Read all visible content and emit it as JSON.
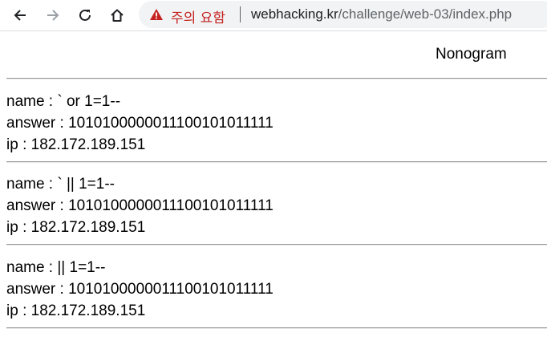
{
  "browser": {
    "back_label": "Back",
    "forward_label": "Forward",
    "reload_label": "Reload",
    "home_label": "Home",
    "security_warning": "주의 요함",
    "url_host": "webhacking.kr",
    "url_path": "/challenge/web-03/index.php"
  },
  "page": {
    "title": "Nonogram"
  },
  "entries": [
    {
      "name": "name : ` or 1=1--",
      "answer": "answer : 1010100000011100101011111",
      "ip": "ip : 182.172.189.151"
    },
    {
      "name": "name : ` || 1=1--",
      "answer": "answer : 1010100000011100101011111",
      "ip": "ip : 182.172.189.151"
    },
    {
      "name": "name : || 1=1--",
      "answer": "answer : 1010100000011100101011111",
      "ip": "ip : 182.172.189.151"
    }
  ],
  "icons": {
    "back": "arrow-left-icon",
    "forward": "arrow-right-icon",
    "reload": "reload-icon",
    "home": "home-icon",
    "warning": "warning-triangle-icon"
  },
  "colors": {
    "warning": "#c5221f",
    "omnibox_bg": "#f1f3f4"
  }
}
